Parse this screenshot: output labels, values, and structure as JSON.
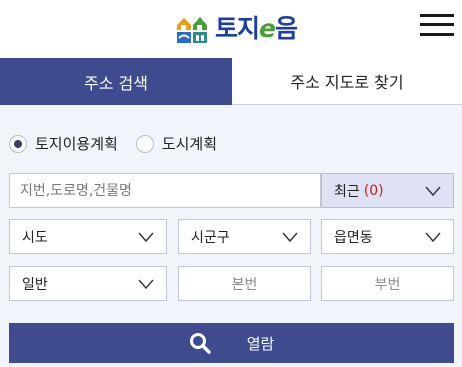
{
  "header": {
    "logo_text_a": "토지",
    "logo_text_e": "e",
    "logo_text_b": "음"
  },
  "tabs": [
    {
      "label": "주소 검색",
      "active": true
    },
    {
      "label": "주소 지도로 찾기",
      "active": false
    }
  ],
  "radio": [
    {
      "label": "토지이용계획",
      "checked": true
    },
    {
      "label": "도시계획",
      "checked": false
    }
  ],
  "search": {
    "placeholder": "지번,도로명,건물명",
    "recent_label": "최근",
    "recent_count": "(0)"
  },
  "selects": {
    "sido": "시도",
    "sigungu": "시군구",
    "eupmyeondong": "읍면동",
    "land_type": "일반"
  },
  "lot_number": {
    "main_placeholder": "본번",
    "sub_placeholder": "부번"
  },
  "view_button": {
    "label": "열람"
  },
  "colors": {
    "primary": "#3e4b8e",
    "panel_bg": "#f1f4fb",
    "recent_bg": "#dfe2f4",
    "count_red": "#d21a1a",
    "logo_blue": "#1d3f9e",
    "logo_green": "#4a9e3a"
  },
  "icons": [
    "house-logo-icon",
    "hamburger-menu-icon",
    "chevron-down-icon",
    "search-icon"
  ]
}
